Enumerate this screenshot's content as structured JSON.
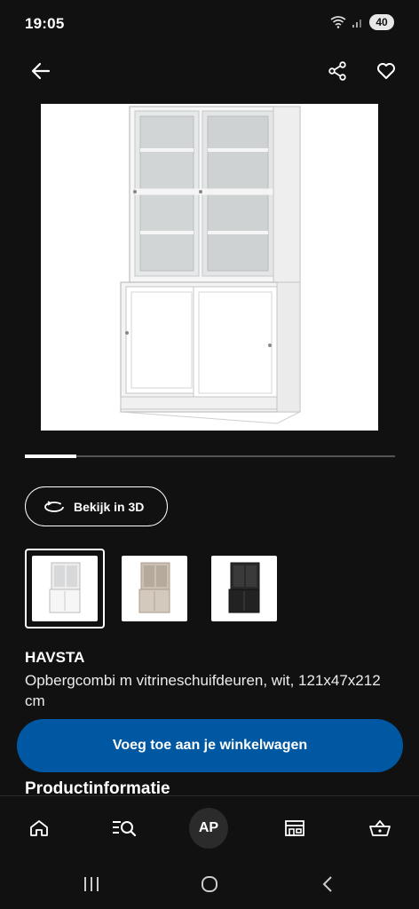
{
  "status_bar": {
    "time": "19:05",
    "battery": "40"
  },
  "header": {
    "back_icon": "arrow-left-icon",
    "share_icon": "share-icon",
    "favorite_icon": "heart-icon"
  },
  "gallery": {
    "image_alt": "HAVSTA cabinet white",
    "progress": 0.14,
    "view_3d_label": "Bekijk in 3D",
    "variants": [
      {
        "name": "wit",
        "selected": true
      },
      {
        "name": "beige",
        "selected": false
      },
      {
        "name": "zwart",
        "selected": false
      }
    ]
  },
  "product": {
    "name": "HAVSTA",
    "description": "Opbergcombi m vitrineschuifdeuren, wit, 121x47x212 cm"
  },
  "actions": {
    "add_to_cart": "Voeg toe aan je winkelwagen"
  },
  "section": {
    "title": "Productinformatie"
  },
  "bottom_nav": {
    "items": [
      "home-icon",
      "search-icon",
      "account-avatar",
      "store-icon",
      "basket-icon"
    ],
    "avatar_initials": "AP"
  },
  "colors": {
    "background": "#111111",
    "primary": "#0058a3",
    "text": "#ffffff"
  }
}
